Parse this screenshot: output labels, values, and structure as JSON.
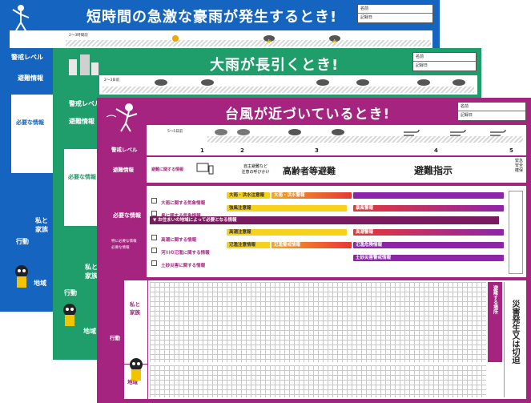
{
  "sheets": {
    "blue": {
      "title": "短時間の急激な豪雨が発生するとき!",
      "name_fields": [
        "名前",
        "記録日"
      ],
      "timeline_label": "2〜3時間前",
      "alert_level_label": "警戒レベル",
      "evacuation_info_label": "避難情報",
      "needed_info_label": "必要な情報",
      "action_label": "行動",
      "family_label": "私と家族",
      "area_label": "地域"
    },
    "green": {
      "title": "大雨が長引くとき!",
      "name_fields": [
        "名前",
        "記録日"
      ],
      "timeline_label": "2〜3日前",
      "alert_level_label": "警戒レベル",
      "evacuation_info_label": "避難情報",
      "needed_info_label": "必要な情報",
      "action_label": "行動",
      "family_label": "私と家族",
      "area_label": "地域"
    },
    "purple": {
      "title": "台風が近づいているとき!",
      "name_fields": [
        "名前",
        "記録日"
      ],
      "timeline_label": "5〜5日前",
      "alert_level_label": "警戒レベル",
      "levels": [
        "1",
        "2",
        "3",
        "4",
        "5"
      ],
      "evacuation_info_label": "避難情報",
      "evacuation_related": "避難に関する情報",
      "self_evac_note": "自主避難など\n注意の呼びかけ",
      "elderly_evac": "高齢者等避難",
      "evac_order": "避難指示",
      "emergency_safety": "緊急安全確保",
      "needed_info_title": "必要な情報",
      "options_a": "特に必要な情報",
      "options_b": "必要な情報",
      "heavy_rain_row": "大雨に関する気象情報",
      "wind_row": "風に関する気象情報",
      "heavy_rain_alert": "大雨・洪水注意報",
      "heavy_rain_warning": "大雨・洪水警報",
      "strong_wind_alert": "強風注意報",
      "storm_warning": "暴風警報",
      "local_info_header": "▼ お住まいの地域によって必要となる情報",
      "high_tide_row": "高潮に関する情報",
      "river_flood_row": "河川の氾濫に関する情報",
      "landslide_row": "土砂災害に関する情報",
      "high_tide_alert": "高潮注意報",
      "high_tide_warning": "高潮警報",
      "flood_alert": "氾濫注意情報",
      "flood_warning": "氾濫警戒情報",
      "flood_danger": "氾濫危険情報",
      "landslide_warning": "土砂災害警戒情報",
      "action_label": "行動",
      "family_label": "私と家族",
      "area_label": "地域",
      "evac_place": "避難する場所",
      "final_note": "災害発生又は切迫"
    }
  }
}
